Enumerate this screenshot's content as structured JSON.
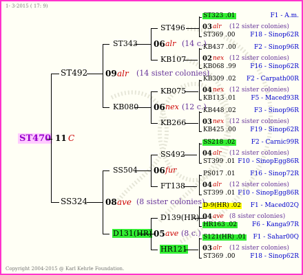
{
  "header": {
    "date": "1- 3-2015 ( 17: 9)"
  },
  "footer": {
    "copyright": "Copyright 2004-2015 @ Karl Kehrle Foundation."
  },
  "root": {
    "id": "ST470",
    "num": "11",
    "mark": "C"
  },
  "gen1": [
    {
      "id": "ST492",
      "num": "09",
      "mark": "alr",
      "note": "(14 sister colonies)"
    },
    {
      "id": "SS324",
      "num": "08",
      "mark": "ave",
      "note": "(8 sister colonies)"
    }
  ],
  "gen2": [
    {
      "id": "ST343",
      "num": "06",
      "mark": "alr",
      "note": "(14 c.)"
    },
    {
      "id": "KB080",
      "num": "06",
      "mark": "nex",
      "note": "(12 c.)"
    },
    {
      "id": "SS504",
      "num": "06",
      "mark": "fur",
      "note": ""
    },
    {
      "id": "D131(HR)",
      "num": "05",
      "mark": "ave",
      "note": "(8 c.)"
    }
  ],
  "gen3": [
    {
      "id": "ST496",
      "num": "03",
      "mark": "alr",
      "note": "(12 sister colonies)"
    },
    {
      "id": "KB107",
      "num": "02",
      "mark": "nex",
      "note": "(12 sister colonies)"
    },
    {
      "id": "KB075",
      "num": "04",
      "mark": "nex",
      "note": "(12 sister colonies)"
    },
    {
      "id": "KB266",
      "num": "03",
      "mark": "nex",
      "note": "(12 sister colonies)"
    },
    {
      "id": "SS492",
      "num": "04",
      "mark": "alr",
      "note": "(12 sister colonies)"
    },
    {
      "id": "FT138",
      "num": "04",
      "mark": "alr",
      "note": "(12 sister colonies)"
    },
    {
      "id": "D139(HR)",
      "num": "04",
      "mark": "ave",
      "note": "(8 sister colonies)"
    },
    {
      "id": "HR121",
      "num": "03",
      "mark": "alr",
      "note": "(12 sister colonies)"
    }
  ],
  "gen4": [
    {
      "id": "ST323",
      "val": ".01",
      "src": "F1 - A.m."
    },
    {
      "id": "ST369",
      "val": ".00",
      "src": "F18 - Sinop62R"
    },
    {
      "id": "KB437",
      "val": ".00",
      "src": "F2 - Sinop96R"
    },
    {
      "id": "KB068",
      "val": ".99",
      "src": "F16 - Sinop62R"
    },
    {
      "id": "KB309",
      "val": ".02",
      "src": "F2 - Carpath00R"
    },
    {
      "id": "KB113",
      "val": ".01",
      "src": "F5 - Maced93R"
    },
    {
      "id": "KB448",
      "val": ".02",
      "src": "F3 - Sinop96R"
    },
    {
      "id": "KB425",
      "val": ".00",
      "src": "F19 - Sinop62R"
    },
    {
      "id": "SS218",
      "val": ".02",
      "src": "F2 - Carnic99R"
    },
    {
      "id": "ST399",
      "val": ".01",
      "src": "F10 - SinopEgg86R"
    },
    {
      "id": "PS017",
      "val": ".01",
      "src": "F16 - Sinop72R"
    },
    {
      "id": "ST399",
      "val": ".01",
      "src": "F10 - SinopEgg86R"
    },
    {
      "id": "D-9(HR)",
      "val": ".02",
      "src": "F1 - Maced02Q"
    },
    {
      "id": "HR163",
      "val": ".02",
      "src": "F6 - Kanga97R"
    },
    {
      "id": "S121(HR)",
      "val": ".01",
      "src": "F1 - Sahar00Q"
    },
    {
      "id": "ST369",
      "val": ".00",
      "src": "F18 - Sinop62R"
    }
  ],
  "colors": {
    "frame": "#ff33cc",
    "highlight_green": "#33ee33",
    "highlight_yellow": "#ffff00",
    "highlight_pink": "#ffccff"
  }
}
